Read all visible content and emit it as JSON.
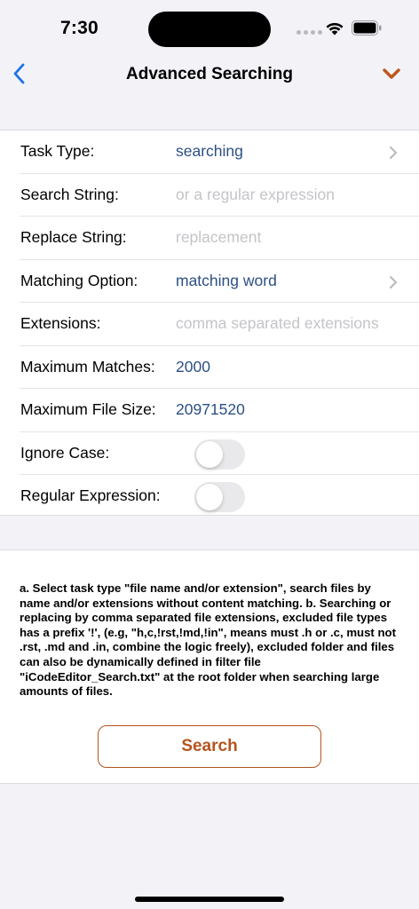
{
  "status": {
    "time": "7:30"
  },
  "nav": {
    "title": "Advanced Searching",
    "back_icon": "chevron-left-icon",
    "menu_icon": "chevron-down-icon",
    "accent": "#1a73e8",
    "menu_color": "#c0561a"
  },
  "form": {
    "task_type": {
      "label": "Task Type:",
      "value": "searching"
    },
    "search_string": {
      "label": "Search String:",
      "placeholder": "or a regular expression"
    },
    "replace_string": {
      "label": "Replace String:",
      "placeholder": "replacement"
    },
    "matching_option": {
      "label": "Matching Option:",
      "value": "matching word"
    },
    "extensions": {
      "label": "Extensions:",
      "placeholder": "comma separated extensions"
    },
    "maximum_matches": {
      "label": "Maximum Matches:",
      "value": "2000"
    },
    "maximum_file_size": {
      "label": "Maximum File Size:",
      "value": "20971520"
    },
    "ignore_case": {
      "label": "Ignore Case:",
      "on": false
    },
    "regular_expression": {
      "label": "Regular Expression:",
      "on": false
    }
  },
  "info": {
    "description": "a. Select task type \"file name and/or extension\", search files by name and/or extensions without content matching. b. Searching or replacing by comma separated file extensions, excluded file types has a prefix '!', (e.g, \"h,c,!rst,!md,!in\", means must .h or .c, must not .rst, .md and .in, combine the logic freely), excluded folder and files can also be dynamically defined in filter file \"iCodeEditor_Search.txt\" at the root folder when searching large amounts of files.",
    "search_button": "Search",
    "button_color": "#b5541c"
  }
}
